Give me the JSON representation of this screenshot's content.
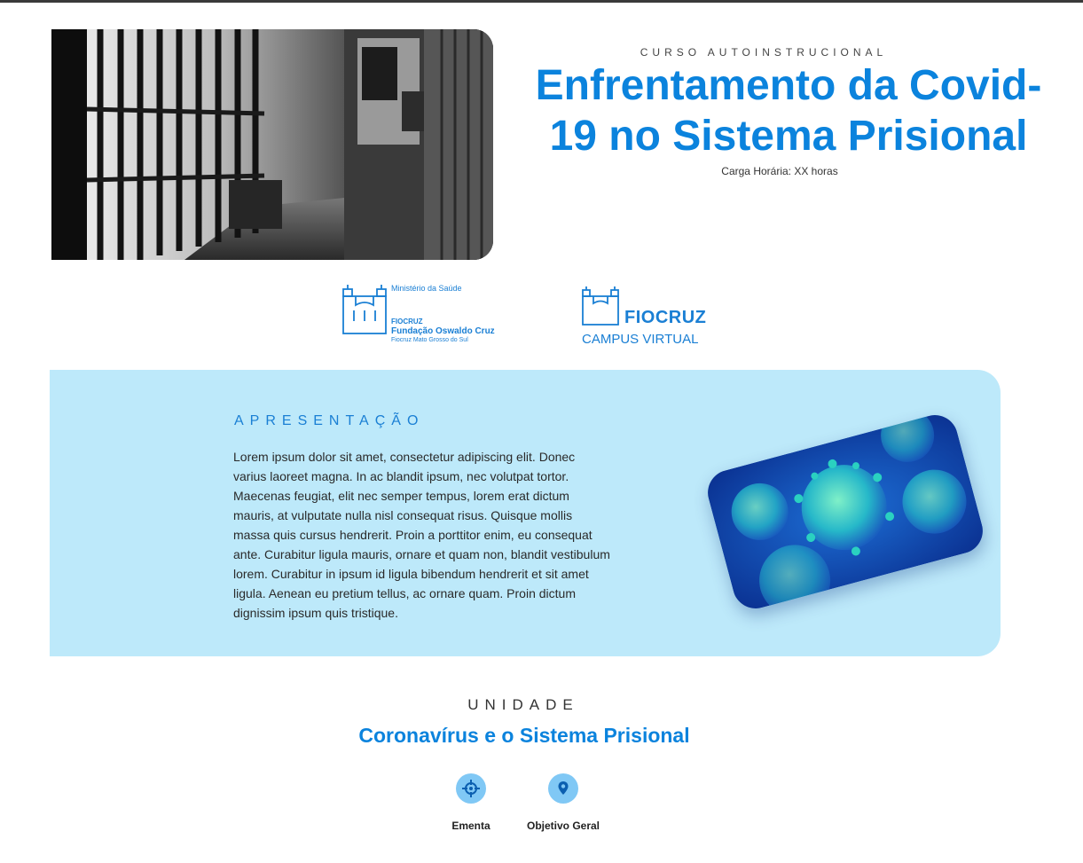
{
  "hero": {
    "eyebrow": "CURSO AUTOINSTRUCIONAL",
    "title": "Enfrentamento da Covid-19 no Sistema Prisional",
    "hours": "Carga Horária: XX horas",
    "image_icon": "prison-corridor-photo"
  },
  "logos": {
    "ministerio": {
      "line1": "Ministério da Saúde",
      "line2": "FIOCRUZ",
      "line3": "Fundação Oswaldo Cruz",
      "line4": "Fiocruz Mato Grosso do Sul"
    },
    "campus": {
      "line1": "FIOCRUZ",
      "line2": "CAMPUS VIRTUAL"
    }
  },
  "presentation": {
    "label": "APRESENTAÇÃO",
    "text": "Lorem ipsum dolor sit amet, consectetur adipiscing elit. Donec varius laoreet magna. In ac blandit ipsum, nec volutpat tortor. Maecenas feugiat, elit nec semper tempus, lorem erat dictum mauris, at vulputate nulla nisl consequat risus. Quisque mollis massa quis cursus hendrerit. Proin a porttitor enim, eu consequat ante. Curabitur ligula mauris, ornare et quam non, blandit vestibulum lorem. Curabitur in ipsum id ligula bibendum hendrerit et sit amet ligula. Aenean eu pretium tellus, ac ornare quam. Proin dictum dignissim ipsum quis tristique.",
    "image_icon": "coronavirus-image"
  },
  "unit": {
    "label": "UNIDADE",
    "title": "Coronavírus e o Sistema Prisional",
    "items": [
      {
        "label": "Ementa",
        "icon": "crosshair-icon"
      },
      {
        "label": "Objetivo Geral",
        "icon": "map-pin-icon"
      }
    ]
  },
  "colors": {
    "accent": "#0b83dd",
    "section_bg": "#bde9fa",
    "icon_circle": "#80c8f5"
  }
}
